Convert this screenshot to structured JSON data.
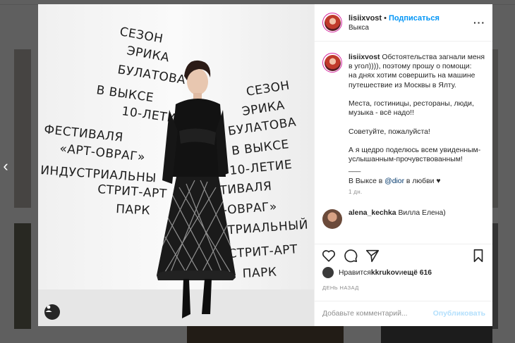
{
  "post": {
    "username": "lisiixvost",
    "follow_label": "Подписаться",
    "location": "Выкса",
    "caption_paragraphs": [
      "Обстоятельства загнали меня в угол)))), поэтому прошу о помощи:\nна днях хотим совершить на машине путешествие из Москвы в Ялту.",
      "Места, гостиницы, рестораны, люди, музыка - всё надо!!",
      "Советуйте, пожалуйста!",
      "А я щедро поделюсь всем увиденным-услышанным-прочувствованным!\n___"
    ],
    "caption_last_prefix": "В Выксе в ",
    "caption_mention": "@dior",
    "caption_last_suffix": " в любви ♥",
    "age": "1 дн.",
    "comment_username": "alena_kechka",
    "comment_text": "Вилла Елена)",
    "likes_prefix": "Нравится ",
    "likes_user": "kkrukov",
    "likes_mid": " и ",
    "likes_count": "ещё 616",
    "timestamp": "ДЕНЬ НАЗАД",
    "comment_placeholder": "Добавьте комментарий...",
    "publish_label": "Опубликовать"
  },
  "photo_text": {
    "left_lines": [
      "СЕЗОН",
      "ЭРИКА",
      "БУЛАТОВА",
      "В ВЫКСЕ",
      "10-ЛЕТИЕ",
      "ФЕСТИВАЛЯ",
      "«АРТ-ОВРАГ»",
      "ИНДУСТРИАЛЬНЫ",
      "СТРИТ-АРТ",
      "ПАРК"
    ],
    "right_lines": [
      "СЕЗОН",
      "ЭРИКА",
      "БУЛАТОВА",
      "В ВЫКСЕ",
      "10-ЛЕТИЕ",
      "ТИВАЛЯ",
      "-ОВРАГ»",
      "УСТРИАЛЬНЫЙ",
      "СТРИТ-АРТ",
      "ПАРК"
    ]
  },
  "icons": {
    "more": "more-options-icon",
    "like": "heart-icon",
    "comment": "comment-icon",
    "share": "share-icon",
    "save": "bookmark-icon",
    "tag": "user-tag-icon",
    "nav": "chevron-left-icon"
  },
  "colors": {
    "accent": "#0095f6",
    "text": "#262626",
    "muted": "#8e8e8e",
    "publish_disabled": "#b2dffc"
  }
}
